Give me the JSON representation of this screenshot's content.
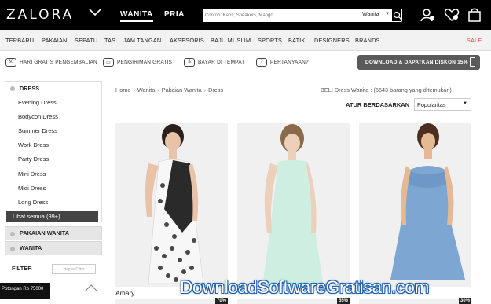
{
  "header": {
    "logo": "ZALORA",
    "nav": [
      {
        "label": "WANITA",
        "active": true
      },
      {
        "label": "PRIA",
        "active": false
      }
    ],
    "search_placeholder": "Contoh: Kaos, Sneakers, Mango...",
    "search_category": "Wanita",
    "icons": [
      "user-icon",
      "wishlist-heart-icon",
      "shopping-bag-icon"
    ]
  },
  "categories": [
    "TERBARU",
    "PAKAIAN",
    "SEPATU",
    "TAS",
    "JAM TANGAN",
    "AKSESORIS",
    "BAJU MUSLIM",
    "SPORTS",
    "BATIK",
    "DESIGNERS",
    "BRANDS",
    "SALE"
  ],
  "info": {
    "items": [
      {
        "icon": "30-days-return-icon",
        "label": "HARI GRATIS PENGEMBALIAN",
        "badge": "30"
      },
      {
        "icon": "delivery-truck-icon",
        "label": "PENGIRIMAN GRATIS"
      },
      {
        "icon": "cash-payment-icon",
        "label": "BAYAR DI TEMPAT"
      },
      {
        "icon": "question-bubble-icon",
        "label": "PERTANYAAN?"
      }
    ],
    "download_label": "DOWNLOAD & DAPATKAN DISKON 15%"
  },
  "sidebar": {
    "section_title": "DRESS",
    "items": [
      "Evening Dress",
      "Bodycon Dress",
      "Summer Dress",
      "Work Dress",
      "Party Dress",
      "Mini Dress",
      "Midi Dress",
      "Long Dress"
    ],
    "see_all": "Lihat semua (99+)",
    "groups": [
      "PAKAIAN WANITA",
      "WANITA"
    ],
    "filter_label": "FILTER",
    "filter_reset": "Hapus Filter",
    "promo": "Potongan Rp 75000"
  },
  "breadcrumb": [
    "Home",
    "Wanita",
    "Pakaian Wanita",
    "Dress"
  ],
  "result_count": "BELI Dress Wanita : (5543 barang yang ditemukan)",
  "sort": {
    "label": "ATUR BERDASARKAN",
    "value": "Popularitas"
  },
  "products": [
    {
      "name": "Amary",
      "discount": "70%",
      "dress_color": "#2b2b2b"
    },
    {
      "name": "",
      "discount": "55%",
      "dress_color": "#cfeee2"
    },
    {
      "name": "",
      "discount": "30%",
      "dress_color": "#7da6d3"
    }
  ],
  "watermark": "DownloadSoftwareGratisan.com"
}
